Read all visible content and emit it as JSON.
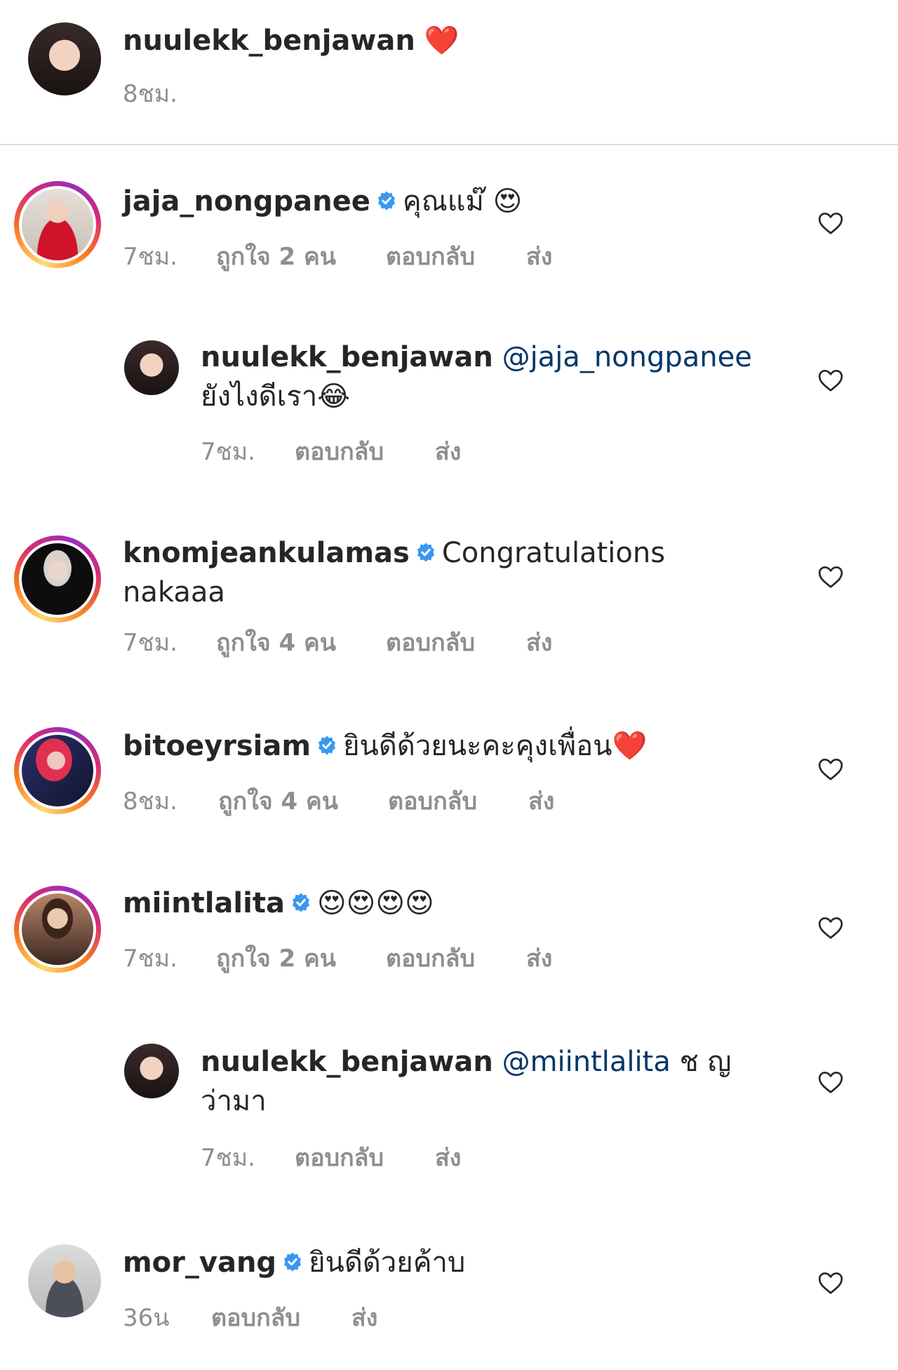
{
  "caption": {
    "username": "nuulekk_benjawan",
    "emoji": "❤️",
    "time": "8ชม."
  },
  "comments": [
    {
      "username": "jaja_nongpanee",
      "verified": true,
      "text": "คุณแม๊",
      "emoji": "😍",
      "time": "7ชม.",
      "likes": "ถูกใจ 2 คน",
      "reply": "ตอบกลับ",
      "send": "ส่ง"
    },
    {
      "username": "nuulekk_benjawan",
      "mention": "@jaja_nongpanee",
      "text": "ยังไงดีเรา",
      "emoji": "😂",
      "time": "7ชม.",
      "reply": "ตอบกลับ",
      "send": "ส่ง"
    },
    {
      "username": "knomjeankulamas",
      "verified": true,
      "text": "Congratulations",
      "text2": "nakaaa",
      "time": "7ชม.",
      "likes": "ถูกใจ 4 คน",
      "reply": "ตอบกลับ",
      "send": "ส่ง"
    },
    {
      "username": "bitoeyrsiam",
      "verified": true,
      "text": "ยินดีด้วยนะคะคุงเพื่อน",
      "emoji": "❤️",
      "time": "8ชม.",
      "likes": "ถูกใจ 4 คน",
      "reply": "ตอบกลับ",
      "send": "ส่ง"
    },
    {
      "username": "miintlalita",
      "verified": true,
      "emoji": "😍😍😍😍",
      "time": "7ชม.",
      "likes": "ถูกใจ 2 คน",
      "reply": "ตอบกลับ",
      "send": "ส่ง"
    },
    {
      "username": "nuulekk_benjawan",
      "mention": "@miintlalita",
      "text": "ช ญ",
      "text2": "ว่ามา",
      "time": "7ชม.",
      "reply": "ตอบกลับ",
      "send": "ส่ง"
    },
    {
      "username": "mor_vang",
      "verified": true,
      "text": "ยินดีด้วยค้าบ",
      "time": "36น",
      "reply": "ตอบกลับ",
      "send": "ส่ง"
    }
  ],
  "icons": {
    "like": "heart-outline-icon",
    "verified": "verified-badge-icon"
  },
  "colors": {
    "text": "#262626",
    "muted": "#8e8e8e",
    "mention": "#00376b",
    "verified": "#3897f0"
  }
}
